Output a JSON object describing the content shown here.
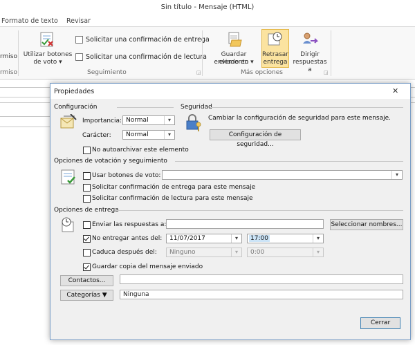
{
  "window": {
    "title": "Sin título  -  Mensaje (HTML)"
  },
  "ribbon": {
    "tabs": [
      {
        "label": "Formato de texto"
      },
      {
        "label": "Revisar"
      }
    ],
    "partial_button": {
      "label_line1": "rmiso",
      "label_line2": "rmiso"
    },
    "voting_button": {
      "label_line1": "Utilizar botones",
      "label_line2": "de voto ▾"
    },
    "request_delivery": {
      "label": "Solicitar una confirmación de entrega",
      "checked": false
    },
    "request_read": {
      "label": "Solicitar una confirmación de lectura",
      "checked": false
    },
    "group_tracking": {
      "label": "Seguimiento"
    },
    "save_sent": {
      "label_line1": "Guardar elemento",
      "label_line2": "enviado en ▾"
    },
    "delay_delivery": {
      "label_line1": "Retrasar",
      "label_line2": "entrega"
    },
    "direct_replies": {
      "label_line1": "Dirigir",
      "label_line2": "respuestas a"
    },
    "group_more": {
      "label": "Más opciones"
    }
  },
  "dialog": {
    "title": "Propiedades",
    "close": "✕",
    "settings": {
      "section": "Configuración",
      "importance_label": "Importancia:",
      "importance_value": "Normal",
      "sensitivity_label": "Carácter:",
      "sensitivity_value": "Normal",
      "no_autoarchive": {
        "label": "No autoarchivar este elemento",
        "checked": false
      }
    },
    "security": {
      "section": "Seguridad",
      "description": "Cambiar la configuración de seguridad para este mensaje.",
      "button": "Configuración de seguridad..."
    },
    "voting": {
      "section": "Opciones de votación y seguimiento",
      "use_voting": {
        "label": "Usar botones de voto:",
        "checked": false
      },
      "voting_value": "",
      "delivery_receipt": {
        "label": "Solicitar confirmación de entrega para este mensaje",
        "checked": false
      },
      "read_receipt": {
        "label": "Solicitar confirmación de lectura para este mensaje",
        "checked": false
      }
    },
    "delivery": {
      "section": "Opciones de entrega",
      "send_replies": {
        "label": "Enviar las respuestas a:",
        "checked": false
      },
      "replies_value": "",
      "select_names": "Seleccionar nombres...",
      "do_not_deliver": {
        "label": "No entregar antes del:",
        "checked": true
      },
      "date_value": "11/07/2017",
      "time_value": "17:00",
      "expires": {
        "label": "Caduca después del:",
        "checked": false
      },
      "expire_date": "Ninguno",
      "expire_time": "0:00",
      "save_copy": {
        "label": "Guardar copia del mensaje enviado",
        "checked": true
      }
    },
    "contacts_button": "Contactos...",
    "contacts_value": "",
    "categories_button": "Categorías  ▼",
    "categories_value": "Ninguna",
    "close_button": "Cerrar"
  },
  "colors": {
    "dialog_border": "#7a9ec6",
    "highlight": "#fbe3a0",
    "selection": "#cce4f7"
  }
}
